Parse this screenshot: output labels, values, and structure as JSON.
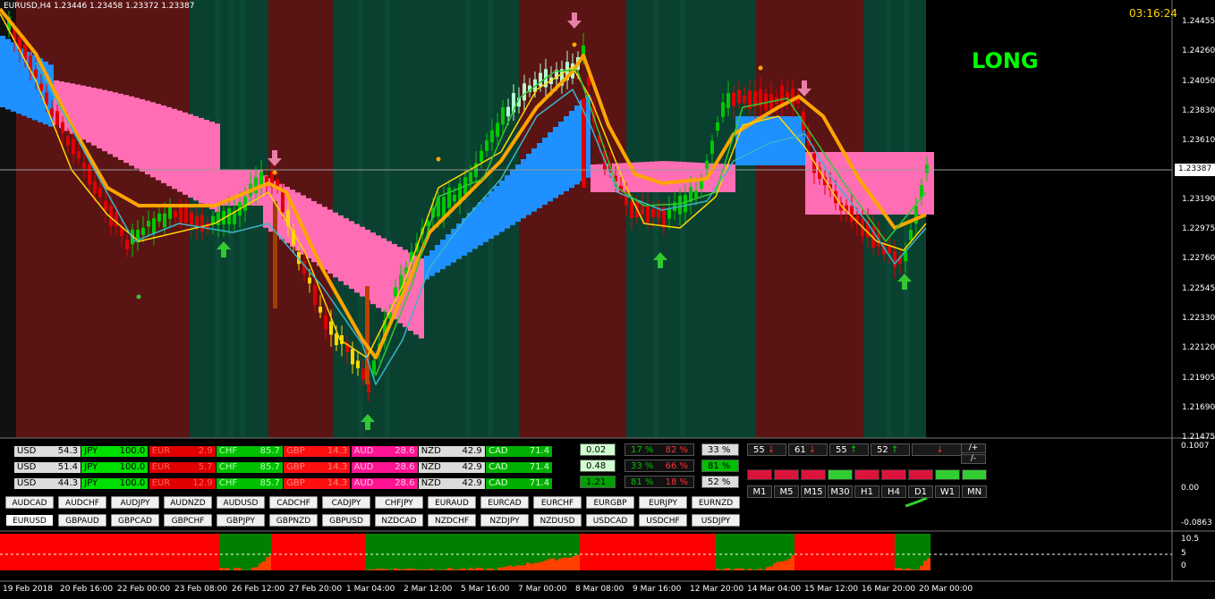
{
  "header": {
    "title": "EURUSD,H4  1.23446 1.23458 1.23372 1.23387",
    "clock": "03:16:24",
    "signal": "LONG"
  },
  "price_axis": {
    "ticks": [
      "1.24455",
      "1.24260",
      "1.24050",
      "1.23830",
      "1.23610",
      "1.23387",
      "1.23190",
      "1.22975",
      "1.22760",
      "1.22545",
      "1.22330",
      "1.22120",
      "1.21905",
      "1.21690",
      "1.21475"
    ],
    "current": "1.23387"
  },
  "sub_axis": {
    "ticks": [
      "0.1007",
      "0.00",
      "-0.0863"
    ]
  },
  "hist_axis": {
    "ticks": [
      "10.5",
      "5",
      "0"
    ]
  },
  "time_axis": [
    "19 Feb 2018",
    "20 Feb 16:00",
    "22 Feb 00:00",
    "23 Feb 08:00",
    "26 Feb 12:00",
    "27 Feb 20:00",
    "1 Mar 04:00",
    "2 Mar 12:00",
    "5 Mar 16:00",
    "7 Mar 00:00",
    "8 Mar 08:00",
    "9 Mar 16:00",
    "12 Mar 20:00",
    "14 Mar 04:00",
    "15 Mar 12:00",
    "16 Mar 20:00",
    "20 Mar 00:00"
  ],
  "strength_rows": [
    [
      {
        "c": "USD",
        "v": "54.3"
      },
      {
        "c": "JPY",
        "v": "100.0"
      },
      {
        "c": "EUR",
        "v": "2.9"
      },
      {
        "c": "CHF",
        "v": "85.7"
      },
      {
        "c": "GBP",
        "v": "14.3"
      },
      {
        "c": "AUD",
        "v": "28.6"
      },
      {
        "c": "NZD",
        "v": "42.9"
      },
      {
        "c": "CAD",
        "v": "71.4"
      }
    ],
    [
      {
        "c": "USD",
        "v": "51.4"
      },
      {
        "c": "JPY",
        "v": "100.0"
      },
      {
        "c": "EUR",
        "v": "5.7"
      },
      {
        "c": "CHF",
        "v": "85.7"
      },
      {
        "c": "GBP",
        "v": "14.3"
      },
      {
        "c": "AUD",
        "v": "28.6"
      },
      {
        "c": "NZD",
        "v": "42.9"
      },
      {
        "c": "CAD",
        "v": "71.4"
      }
    ],
    [
      {
        "c": "USD",
        "v": "44.3"
      },
      {
        "c": "JPY",
        "v": "100.0"
      },
      {
        "c": "EUR",
        "v": "12.9"
      },
      {
        "c": "CHF",
        "v": "85.7"
      },
      {
        "c": "GBP",
        "v": "14.3"
      },
      {
        "c": "AUD",
        "v": "28.6"
      },
      {
        "c": "NZD",
        "v": "42.9"
      },
      {
        "c": "CAD",
        "v": "71.4"
      }
    ]
  ],
  "stats": [
    {
      "a": "0.02",
      "b1": "17 %",
      "b2": "82 %",
      "c": "33 %"
    },
    {
      "a": "0.48",
      "b1": "33 %",
      "b2": "66 %",
      "c": "81 %"
    },
    {
      "a": "1.21",
      "b1": "81 %",
      "b2": "18 %",
      "c": "52 %"
    }
  ],
  "signals": [
    "55 ↓",
    "61 ↓",
    "55 ↑",
    "52 ↑",
    "↓"
  ],
  "mini_buttons": [
    "/+",
    "/-"
  ],
  "timeframes": [
    "M1",
    "M5",
    "M15",
    "M30",
    "H1",
    "H4",
    "D1",
    "W1",
    "MN"
  ],
  "pairs_row1": [
    "AUDCAD",
    "AUDCHF",
    "AUDJPY",
    "AUDNZD",
    "AUDUSD",
    "CADCHF",
    "CADJPY",
    "CHFJPY",
    "EURAUD",
    "EURCAD",
    "EURCHF",
    "EURGBP",
    "EURJPY",
    "EURNZD"
  ],
  "pairs_row2": [
    "EURUSD",
    "GBPAUD",
    "GBPCAD",
    "GBPCHF",
    "GBPJPY",
    "GBPNZD",
    "GBPUSD",
    "NZDCAD",
    "NZDCHF",
    "NZDJPY",
    "NZDUSD",
    "USDCAD",
    "USDCHF",
    "USDJPY"
  ],
  "selected_pair": "EURUSD",
  "colors": {
    "bull": "#00c800",
    "bear": "#e00000",
    "pink": "#ff6eb4",
    "blue": "#1e90ff",
    "orange": "#ffa500",
    "yellow": "#ffd700",
    "bg_red": "#5a1414",
    "bg_green": "#0a4030"
  }
}
